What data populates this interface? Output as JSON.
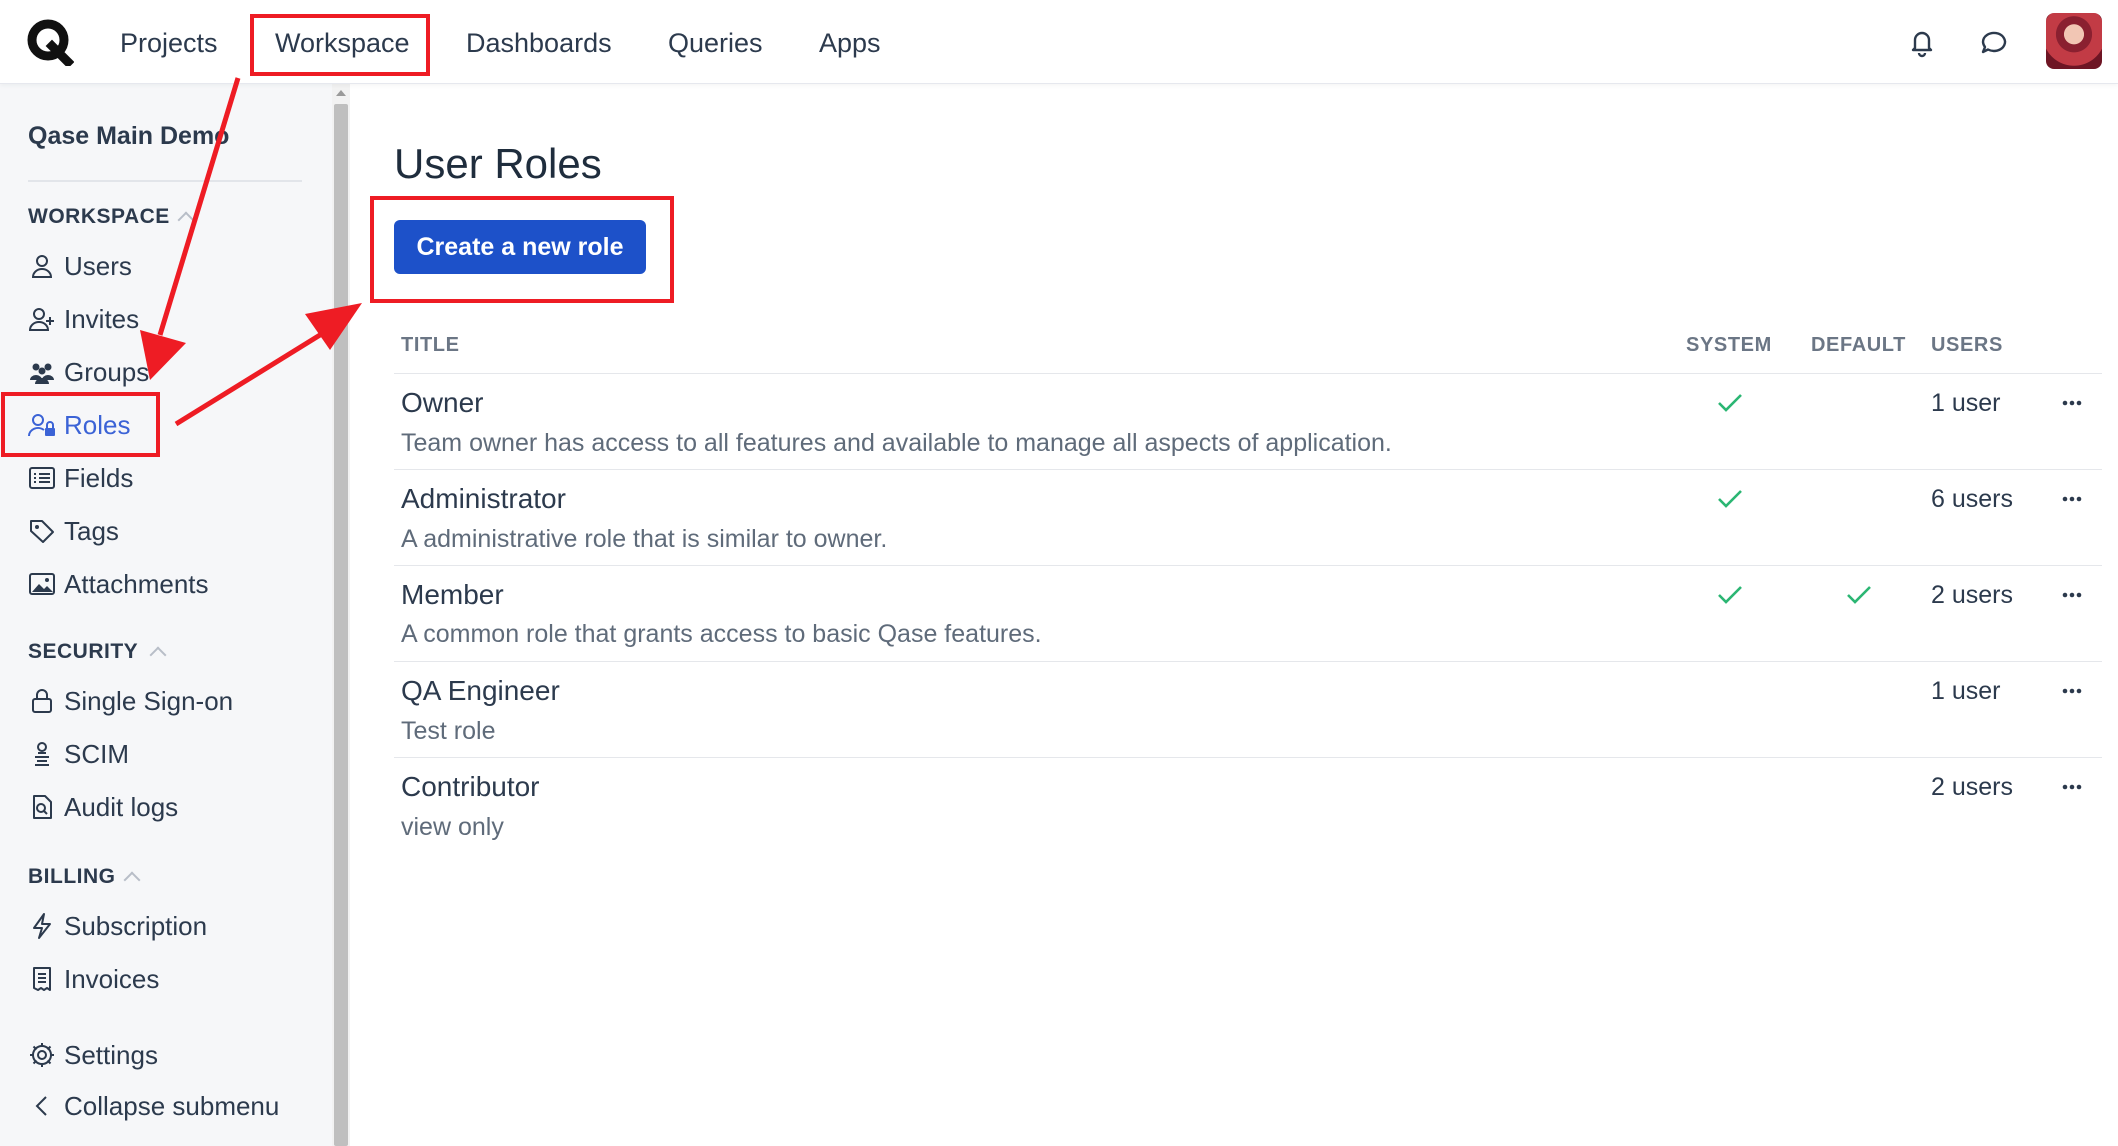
{
  "topnav": {
    "logo_letter": "Q",
    "items": [
      {
        "label": "Projects"
      },
      {
        "label": "Workspace"
      },
      {
        "label": "Dashboards"
      },
      {
        "label": "Queries"
      },
      {
        "label": "Apps"
      }
    ],
    "icons": [
      "bell-icon",
      "chat-icon"
    ]
  },
  "sidebar": {
    "workspace_name": "Qase Main Demo",
    "sections": {
      "workspace": "WORKSPACE",
      "security": "SECURITY",
      "billing": "BILLING"
    },
    "workspace_items": [
      {
        "label": "Users",
        "icon": "user-icon"
      },
      {
        "label": "Invites",
        "icon": "user-plus-icon"
      },
      {
        "label": "Groups",
        "icon": "group-icon"
      },
      {
        "label": "Roles",
        "icon": "user-lock-icon",
        "active": true
      },
      {
        "label": "Fields",
        "icon": "list-icon"
      },
      {
        "label": "Tags",
        "icon": "tag-icon"
      },
      {
        "label": "Attachments",
        "icon": "image-icon"
      }
    ],
    "security_items": [
      {
        "label": "Single Sign-on",
        "icon": "lock-icon"
      },
      {
        "label": "SCIM",
        "icon": "scim-icon"
      },
      {
        "label": "Audit logs",
        "icon": "file-search-icon"
      }
    ],
    "billing_items": [
      {
        "label": "Subscription",
        "icon": "bolt-icon"
      },
      {
        "label": "Invoices",
        "icon": "receipt-icon"
      }
    ],
    "settings_label": "Settings",
    "collapse_label": "Collapse submenu"
  },
  "main": {
    "title": "User Roles",
    "create_button": "Create a new role",
    "columns": {
      "title": "TITLE",
      "system": "SYSTEM",
      "default": "DEFAULT",
      "users": "USERS"
    },
    "roles": [
      {
        "title": "Owner",
        "description": "Team owner has access to all features and available to manage all aspects of application.",
        "system": true,
        "default": false,
        "users": "1 user"
      },
      {
        "title": "Administrator",
        "description": "A administrative role that is similar to owner.",
        "system": true,
        "default": false,
        "users": "6 users"
      },
      {
        "title": "Member",
        "description": "A common role that grants access to basic Qase features.",
        "system": true,
        "default": true,
        "users": "2 users"
      },
      {
        "title": "QA Engineer",
        "description": "Test role",
        "system": false,
        "default": false,
        "users": "1 user"
      },
      {
        "title": "Contributor",
        "description": "view only",
        "system": false,
        "default": false,
        "users": "2 users"
      }
    ]
  },
  "colors": {
    "accent": "#1d51c9",
    "active_link": "#3b63d6",
    "check": "#2bb673",
    "annotation": "#ee1c24"
  }
}
